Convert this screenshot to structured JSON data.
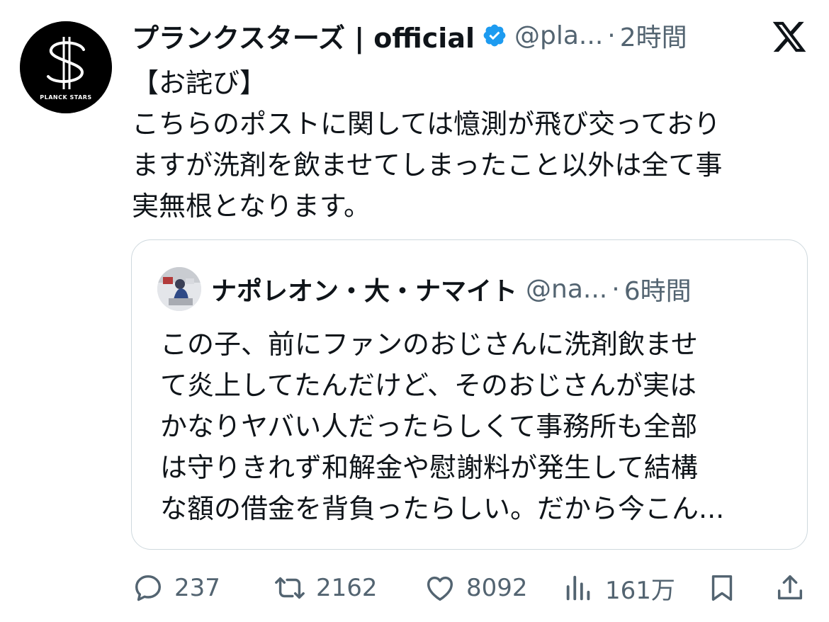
{
  "post": {
    "display_name": "プランクスターズ | official",
    "handle": "@pla...",
    "separator": "·",
    "time": "2時間",
    "avatar_logo_text": "PLANCK STARS",
    "body_lines": [
      "【お詫び】",
      "こちらのポストに関しては憶測が飛び交っており",
      "ますが洗剤を飲ませてしまったこと以外は全て事",
      "実無根となります。"
    ]
  },
  "quote": {
    "display_name": "ナポレオン・大・ナマイト",
    "handle": "@na...",
    "separator": "·",
    "time": "6時間",
    "body_lines": [
      "この子、前にファンのおじさんに洗剤飲ませ",
      "て炎上してたんだけど、そのおじさんが実は",
      "かなりヤバい人だったらしくて事務所も全部",
      "は守りきれず和解金や慰謝料が発生して結構",
      "な額の借金を背負ったらしい。だから今こん..."
    ]
  },
  "actions": {
    "reply_count": "237",
    "repost_count": "2162",
    "like_count": "8092",
    "views_count": "161万"
  },
  "colors": {
    "text": "#0f1419",
    "secondary": "#536471",
    "verified": "#1d9bf0",
    "border": "#cfd9de"
  }
}
